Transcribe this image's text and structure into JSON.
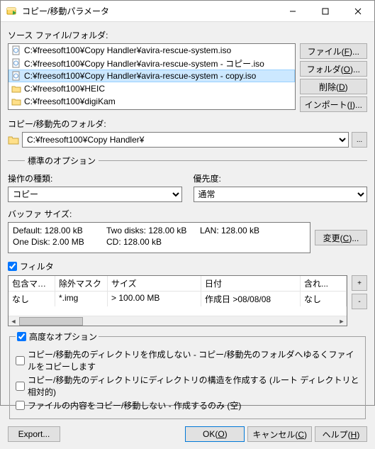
{
  "window": {
    "title": "コピー/移動パラメータ",
    "min": "—",
    "max": "☐",
    "close": "✕"
  },
  "source": {
    "label": "ソース ファイル/フォルダ:",
    "items": [
      {
        "type": "file",
        "text": "C:¥freesoft100¥Copy Handler¥avira-rescue-system.iso"
      },
      {
        "type": "file",
        "text": "C:¥freesoft100¥Copy Handler¥avira-rescue-system - コピー.iso"
      },
      {
        "type": "file",
        "text": "C:¥freesoft100¥Copy Handler¥avira-rescue-system - copy.iso",
        "selected": true
      },
      {
        "type": "folder",
        "text": "C:¥freesoft100¥HEIC"
      },
      {
        "type": "folder",
        "text": "C:¥freesoft100¥digiKam"
      }
    ],
    "buttons": {
      "file": "ファイル(F)...",
      "folder": "フォルダ(O)...",
      "delete": "削除(D)",
      "import": "インポート(I)..."
    }
  },
  "dest": {
    "label": "コピー/移動先のフォルダ:",
    "value": "C:¥freesoft100¥Copy Handler¥",
    "browse": "..."
  },
  "std_group": "標準のオプション",
  "op": {
    "label": "操作の種類:",
    "value": "コピー"
  },
  "prio": {
    "label": "優先度:",
    "value": "通常"
  },
  "buffer": {
    "label": "バッファ サイズ:",
    "default": "Default: 128.00 kB",
    "one": "One Disk: 2.00 MB",
    "two": "Two disks: 128.00 kB",
    "cd": "CD: 128.00 kB",
    "lan": "LAN: 128.00 kB",
    "change": "変更(C)..."
  },
  "filter": {
    "check_label": "フィルタ",
    "add": "+",
    "remove": "-",
    "headers": {
      "c1": "包含マスク",
      "c2": "除外マスク",
      "c3": "サイズ",
      "c4": "日付",
      "c5": "含れ..."
    },
    "row": {
      "c1": "なし",
      "c2": "*.img",
      "c3": "> 100.00 MB",
      "c4": "作成日 >08/08/08",
      "c5": "なし"
    }
  },
  "adv": {
    "legend": "高度なオプション",
    "o1": "コピー/移動先のディレクトリを作成しない - コピー/移動先のフォルダへゆるくファイルをコピーします",
    "o2": "コピー/移動先のディレクトリにディレクトリの構造を作成する (ルート ディレクトリと相対的)",
    "o3": "ファイルの内容をコピー/移動しない - 作成するのみ (空)"
  },
  "footer": {
    "export": "Export...",
    "ok": "OK(O)",
    "cancel": "キャンセル(C)",
    "help": "ヘルプ(H)"
  }
}
